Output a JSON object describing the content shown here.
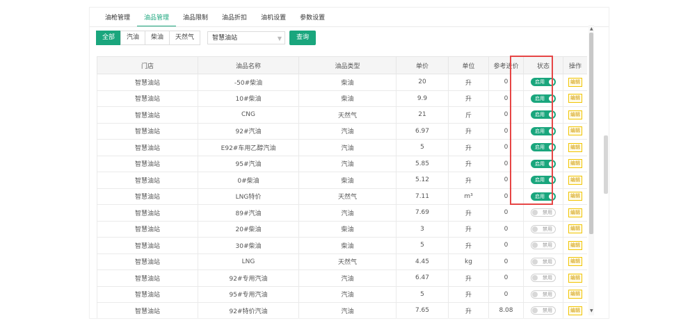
{
  "tabs": [
    "油枪管理",
    "油品管理",
    "油品限制",
    "油品折扣",
    "油机设置",
    "参数设置"
  ],
  "active_tab": 1,
  "filters": {
    "buttons": [
      "全部",
      "汽油",
      "柴油",
      "天然气"
    ],
    "active": 0,
    "station_select": "智慧油站",
    "query_label": "查询"
  },
  "table": {
    "headers": [
      "门店",
      "油品名称",
      "油品类型",
      "单价",
      "单位",
      "参考进价",
      "状态",
      "操作"
    ],
    "rows": [
      {
        "store": "智慧油站",
        "name": "-50#柴油",
        "type": "柴油",
        "price": "20",
        "unit": "升",
        "ref": "0",
        "status": "启用",
        "on": true,
        "op": "编辑"
      },
      {
        "store": "智慧油站",
        "name": "10#柴油",
        "type": "柴油",
        "price": "9.9",
        "unit": "升",
        "ref": "0",
        "status": "启用",
        "on": true,
        "op": "编辑"
      },
      {
        "store": "智慧油站",
        "name": "CNG",
        "type": "天然气",
        "price": "21",
        "unit": "斤",
        "ref": "0",
        "status": "启用",
        "on": true,
        "op": "编辑"
      },
      {
        "store": "智慧油站",
        "name": "92#汽油",
        "type": "汽油",
        "price": "6.97",
        "unit": "升",
        "ref": "0",
        "status": "启用",
        "on": true,
        "op": "编辑"
      },
      {
        "store": "智慧油站",
        "name": "E92#车用乙醇汽油",
        "type": "汽油",
        "price": "5",
        "unit": "升",
        "ref": "0",
        "status": "启用",
        "on": true,
        "op": "编辑"
      },
      {
        "store": "智慧油站",
        "name": "95#汽油",
        "type": "汽油",
        "price": "5.85",
        "unit": "升",
        "ref": "0",
        "status": "启用",
        "on": true,
        "op": "编辑"
      },
      {
        "store": "智慧油站",
        "name": "0#柴油",
        "type": "柴油",
        "price": "5.12",
        "unit": "升",
        "ref": "0",
        "status": "启用",
        "on": true,
        "op": "编辑"
      },
      {
        "store": "智慧油站",
        "name": "LNG特价",
        "type": "天然气",
        "price": "7.11",
        "unit": "m³",
        "ref": "0",
        "status": "启用",
        "on": true,
        "op": "编辑"
      },
      {
        "store": "智慧油站",
        "name": "89#汽油",
        "type": "汽油",
        "price": "7.69",
        "unit": "升",
        "ref": "0",
        "status": "禁用",
        "on": false,
        "op": "编辑"
      },
      {
        "store": "智慧油站",
        "name": "20#柴油",
        "type": "柴油",
        "price": "3",
        "unit": "升",
        "ref": "0",
        "status": "禁用",
        "on": false,
        "op": "编辑"
      },
      {
        "store": "智慧油站",
        "name": "30#柴油",
        "type": "柴油",
        "price": "5",
        "unit": "升",
        "ref": "0",
        "status": "禁用",
        "on": false,
        "op": "编辑"
      },
      {
        "store": "智慧油站",
        "name": "LNG",
        "type": "天然气",
        "price": "4.45",
        "unit": "kg",
        "ref": "0",
        "status": "禁用",
        "on": false,
        "op": "编辑"
      },
      {
        "store": "智慧油站",
        "name": "92#专用汽油",
        "type": "汽油",
        "price": "6.47",
        "unit": "升",
        "ref": "0",
        "status": "禁用",
        "on": false,
        "op": "编辑"
      },
      {
        "store": "智慧油站",
        "name": "95#专用汽油",
        "type": "汽油",
        "price": "5",
        "unit": "升",
        "ref": "0",
        "status": "禁用",
        "on": false,
        "op": "编辑"
      },
      {
        "store": "智慧油站",
        "name": "92#特价汽油",
        "type": "汽油",
        "price": "7.65",
        "unit": "升",
        "ref": "8.08",
        "status": "禁用",
        "on": false,
        "op": "编辑"
      }
    ]
  },
  "colors": {
    "accent": "#1aa67d",
    "highlight": "#e64545",
    "edit": "#f1c400"
  }
}
